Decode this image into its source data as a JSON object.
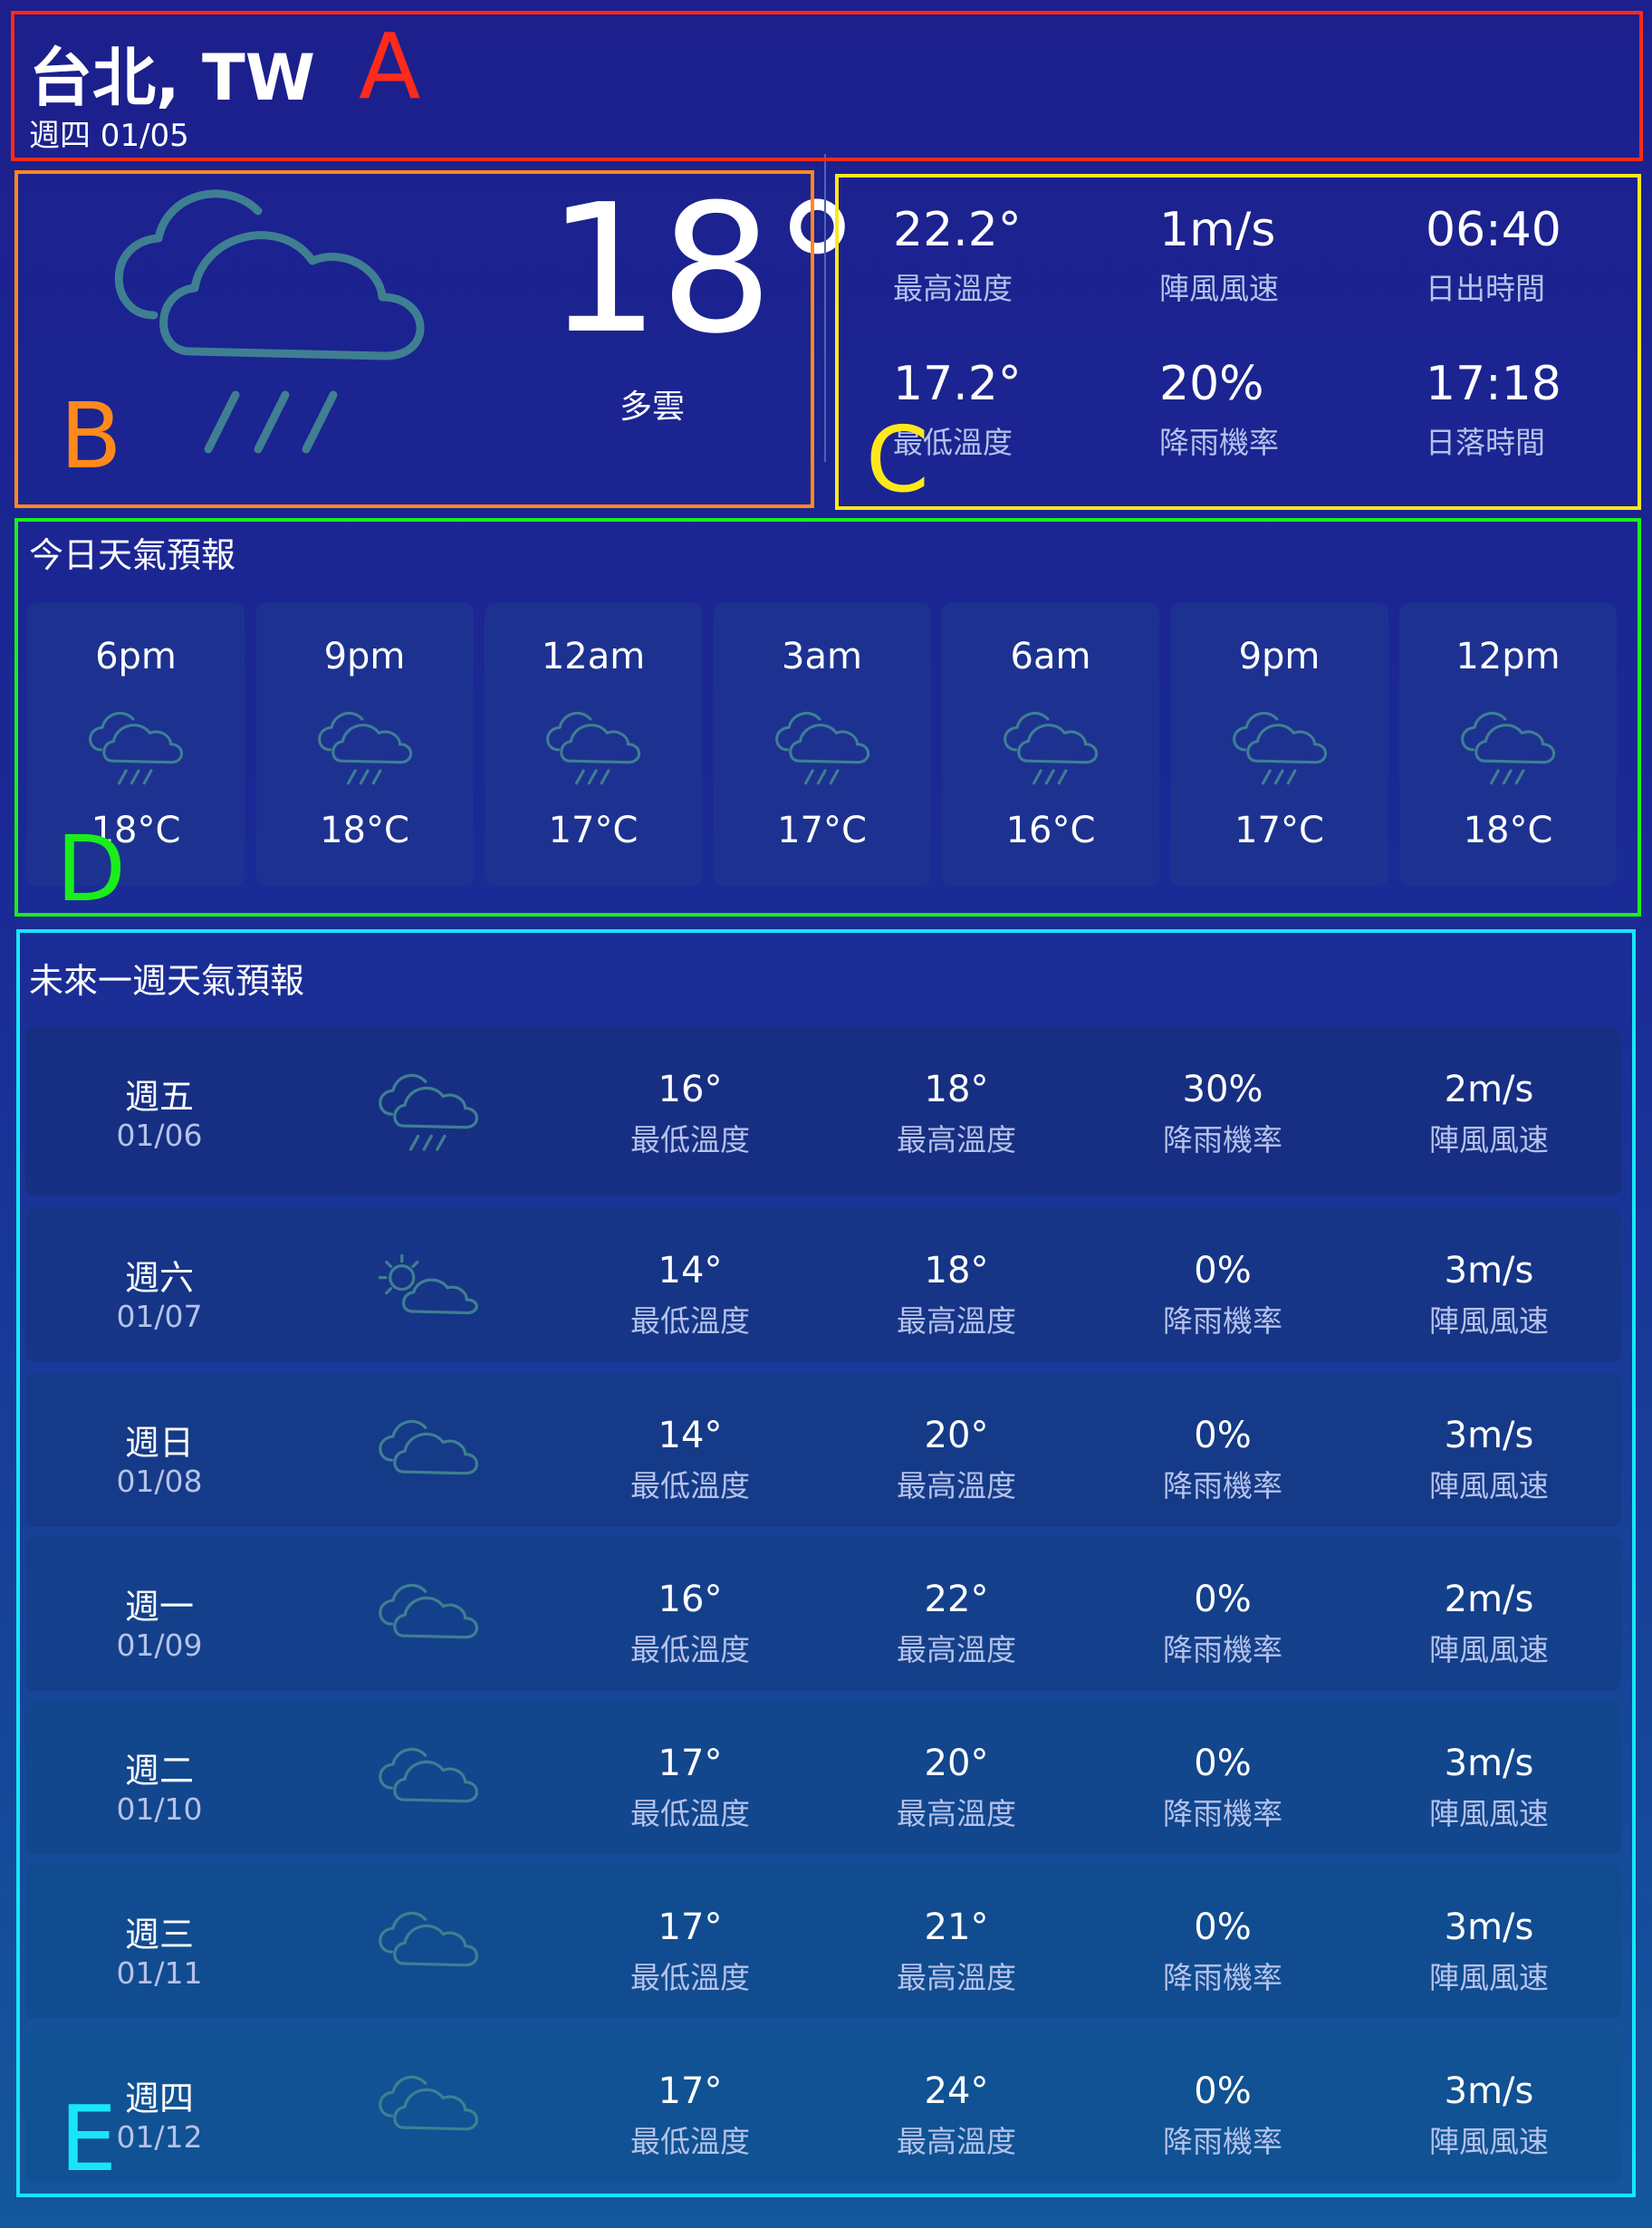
{
  "region_labels": {
    "a": "A",
    "b": "B",
    "c": "C",
    "d": "D",
    "e": "E"
  },
  "location": {
    "city": "台北, TW",
    "date": "週四 01/05"
  },
  "current": {
    "temp": "18°",
    "desc": "多雲",
    "icon": "cloud-rain-icon"
  },
  "stats": [
    {
      "value": "22.2°",
      "label": "最高溫度"
    },
    {
      "value": "1m/s",
      "label": "陣風風速"
    },
    {
      "value": "06:40",
      "label": "日出時間"
    },
    {
      "value": "17.2°",
      "label": "最低溫度"
    },
    {
      "value": "20%",
      "label": "降雨機率"
    },
    {
      "value": "17:18",
      "label": "日落時間"
    }
  ],
  "today": {
    "title": "今日天氣預報",
    "items": [
      {
        "time": "6pm",
        "temp": "18°C",
        "icon": "cloud-rain-icon"
      },
      {
        "time": "9pm",
        "temp": "18°C",
        "icon": "cloud-rain-icon"
      },
      {
        "time": "12am",
        "temp": "17°C",
        "icon": "cloud-rain-icon"
      },
      {
        "time": "3am",
        "temp": "17°C",
        "icon": "cloud-rain-icon"
      },
      {
        "time": "6am",
        "temp": "16°C",
        "icon": "cloud-rain-icon"
      },
      {
        "time": "9pm",
        "temp": "17°C",
        "icon": "cloud-rain-icon"
      },
      {
        "time": "12pm",
        "temp": "18°C",
        "icon": "cloud-rain-icon"
      }
    ]
  },
  "week": {
    "title": "未來一週天氣預報",
    "labels": {
      "low": "最低溫度",
      "high": "最高溫度",
      "rain": "降雨機率",
      "wind": "陣風風速"
    },
    "days": [
      {
        "day": "週五",
        "date": "01/06",
        "icon": "cloud-rain-icon",
        "low": "16°",
        "high": "18°",
        "rain": "30%",
        "wind": "2m/s"
      },
      {
        "day": "週六",
        "date": "01/07",
        "icon": "sun-cloud-icon",
        "low": "14°",
        "high": "18°",
        "rain": "0%",
        "wind": "3m/s"
      },
      {
        "day": "週日",
        "date": "01/08",
        "icon": "cloud-icon",
        "low": "14°",
        "high": "20°",
        "rain": "0%",
        "wind": "3m/s"
      },
      {
        "day": "週一",
        "date": "01/09",
        "icon": "cloud-icon",
        "low": "16°",
        "high": "22°",
        "rain": "0%",
        "wind": "2m/s"
      },
      {
        "day": "週二",
        "date": "01/10",
        "icon": "cloud-icon",
        "low": "17°",
        "high": "20°",
        "rain": "0%",
        "wind": "3m/s"
      },
      {
        "day": "週三",
        "date": "01/11",
        "icon": "cloud-icon",
        "low": "17°",
        "high": "21°",
        "rain": "0%",
        "wind": "3m/s"
      },
      {
        "day": "週四",
        "date": "01/12",
        "icon": "cloud-icon",
        "low": "17°",
        "high": "24°",
        "rain": "0%",
        "wind": "3m/s"
      }
    ]
  },
  "colors": {
    "icon_stroke": "#3f7f92",
    "highlight_a": "#ff2a1a",
    "highlight_b": "#ff8a1a",
    "highlight_c": "#ffe81a",
    "highlight_d": "#1aee1a",
    "highlight_e": "#18e6f8"
  }
}
